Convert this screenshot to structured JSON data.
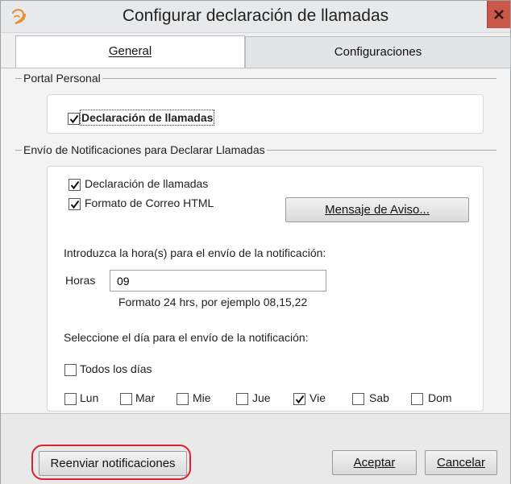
{
  "window": {
    "title": "Configurar declaración de llamadas"
  },
  "tabs": [
    {
      "label": "General",
      "active": true
    },
    {
      "label": "Configuraciones",
      "active": false
    }
  ],
  "portal": {
    "group_label": "Portal Personal",
    "checkbox": {
      "label": "Declaración de llamadas",
      "checked": true
    }
  },
  "notifications": {
    "group_label": "Envío de Notificaciones para Declarar Llamadas",
    "declaracion": {
      "label": "Declaración de llamadas",
      "checked": true
    },
    "html_format": {
      "label": "Formato de Correo HTML",
      "checked": true
    },
    "aviso_button": "Mensaje de Aviso...",
    "hours_prompt": "Introduzca la hora(s) para el envío de la notificación:",
    "hours_label": "Horas",
    "hours_value": "09",
    "hours_hint": "Formato 24 hrs, por ejemplo 08,15,22",
    "days_prompt": "Seleccione el día para el envío de la notificación:",
    "all_days": {
      "label": "Todos los días",
      "checked": false
    },
    "days": [
      {
        "label": "Lun",
        "checked": false
      },
      {
        "label": "Mar",
        "checked": false
      },
      {
        "label": "Mie",
        "checked": false
      },
      {
        "label": "Jue",
        "checked": false
      },
      {
        "label": "Vie",
        "checked": true
      },
      {
        "label": "Sab",
        "checked": false
      },
      {
        "label": "Dom",
        "checked": false
      }
    ]
  },
  "footer": {
    "resend_button": "Reenviar notificaciones",
    "accept_button": "Aceptar",
    "cancel_button": "Cancelar"
  },
  "colors": {
    "highlight": "#d9232a",
    "close": "#c9584a"
  }
}
